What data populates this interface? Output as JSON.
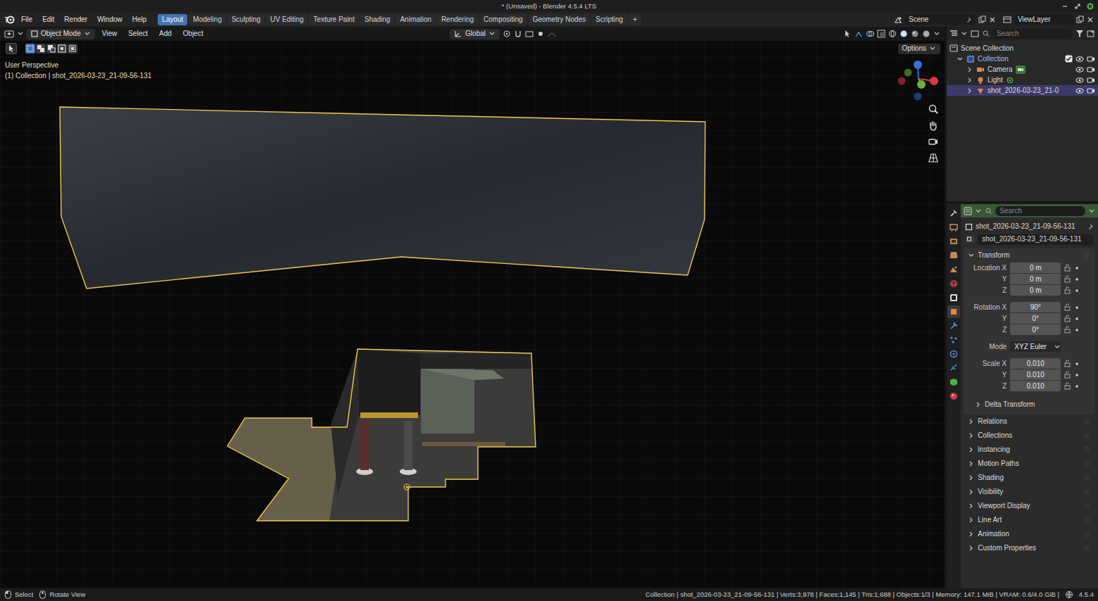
{
  "window": {
    "title": "* (Unsaved) - Blender 4.5.4 LTS"
  },
  "menu": [
    "File",
    "Edit",
    "Render",
    "Window",
    "Help"
  ],
  "workspaces": [
    {
      "label": "Layout",
      "selected": true
    },
    {
      "label": "Modeling",
      "selected": false
    },
    {
      "label": "Sculpting",
      "selected": false
    },
    {
      "label": "UV Editing",
      "selected": false
    },
    {
      "label": "Texture Paint",
      "selected": false
    },
    {
      "label": "Shading",
      "selected": false
    },
    {
      "label": "Animation",
      "selected": false
    },
    {
      "label": "Rendering",
      "selected": false
    },
    {
      "label": "Compositing",
      "selected": false
    },
    {
      "label": "Geometry Nodes",
      "selected": false
    },
    {
      "label": "Scripting",
      "selected": false
    }
  ],
  "add_workspace": "+",
  "scene": "Scene",
  "view_layer": "ViewLayer",
  "viewport_header": {
    "mode": "Object Mode",
    "menus": [
      "View",
      "Select",
      "Add",
      "Object"
    ],
    "orientation": "Global",
    "options": "Options"
  },
  "viewport": {
    "lines": [
      "User Perspective",
      "(1) Collection | shot_2026-03-23_21-09-56-131"
    ]
  },
  "outliner": {
    "search_placeholder": "Search",
    "items": [
      {
        "label": "Scene Collection",
        "kind": "scene",
        "selected": false
      },
      {
        "label": "Collection",
        "kind": "collection",
        "selected": false,
        "expanded": true,
        "included": true,
        "visible": true,
        "renderable": true
      },
      {
        "label": "Camera",
        "kind": "camera",
        "selected": false,
        "expanded": false,
        "visible": true,
        "renderable": true
      },
      {
        "label": "Light",
        "kind": "light",
        "selected": false,
        "expanded": false,
        "visible": true,
        "renderable": true
      },
      {
        "label": "shot_2026-03-23_21-0",
        "kind": "mesh",
        "selected": true,
        "expanded": false,
        "visible": true,
        "renderable": true
      }
    ]
  },
  "properties": {
    "search_placeholder": "Search",
    "object_name": "shot_2026-03-23_21-09-56-131",
    "data_name": "shot_2026-03-23_21-09-56-131",
    "tabs": [
      {
        "kind": "tool",
        "selected": false
      },
      {
        "kind": "render",
        "selected": false
      },
      {
        "kind": "output",
        "selected": false
      },
      {
        "kind": "view_layer",
        "selected": false
      },
      {
        "kind": "scene",
        "selected": false
      },
      {
        "kind": "world",
        "selected": false
      },
      {
        "kind": "collection",
        "selected": false
      },
      {
        "kind": "object",
        "selected": true
      },
      {
        "kind": "modifiers",
        "selected": false
      },
      {
        "kind": "particles",
        "selected": false
      },
      {
        "kind": "physics",
        "selected": false
      },
      {
        "kind": "constraints",
        "selected": false
      },
      {
        "kind": "data",
        "selected": false
      },
      {
        "kind": "material",
        "selected": false
      }
    ],
    "transform": {
      "title": "Transform",
      "expanded": true,
      "groups": [
        {
          "rows": [
            {
              "label": "Location X",
              "value": "0 m",
              "kind": "number"
            },
            {
              "label": "Y",
              "value": "0 m",
              "kind": "number"
            },
            {
              "label": "Z",
              "value": "0 m",
              "kind": "number"
            }
          ]
        },
        {
          "rows": [
            {
              "label": "Rotation X",
              "value": "90°",
              "kind": "number"
            },
            {
              "label": "Y",
              "value": "0°",
              "kind": "number"
            },
            {
              "label": "Z",
              "value": "0°",
              "kind": "number"
            }
          ]
        },
        {
          "rows": [
            {
              "label": "Mode",
              "value": "XYZ Euler",
              "kind": "dropdown"
            }
          ]
        },
        {
          "rows": [
            {
              "label": "Scale X",
              "value": "0.010",
              "kind": "number"
            },
            {
              "label": "Y",
              "value": "0.010",
              "kind": "number"
            },
            {
              "label": "Z",
              "value": "0.010",
              "kind": "number"
            }
          ]
        }
      ],
      "subpanels": [
        {
          "label": "Delta Transform",
          "expanded": false
        }
      ]
    },
    "panels": [
      {
        "label": "Relations",
        "expanded": false
      },
      {
        "label": "Collections",
        "expanded": false
      },
      {
        "label": "Instancing",
        "expanded": false
      },
      {
        "label": "Motion Paths",
        "expanded": false
      },
      {
        "label": "Shading",
        "expanded": false
      },
      {
        "label": "Visibility",
        "expanded": false
      },
      {
        "label": "Viewport Display",
        "expanded": false
      },
      {
        "label": "Line Art",
        "expanded": false
      },
      {
        "label": "Animation",
        "expanded": false
      },
      {
        "label": "Custom Properties",
        "expanded": false
      }
    ]
  },
  "status": {
    "hints": [
      "Select",
      "Rotate View"
    ],
    "stats": "Collection | shot_2026-03-23_21-09-56-131 | Verts:3,978 | Faces:1,145 | Tris:1,688 | Objects:1/3 | Memory: 147.1 MiB | VRAM: 0.6/4.0 GiB |",
    "version": "4.5.4"
  }
}
